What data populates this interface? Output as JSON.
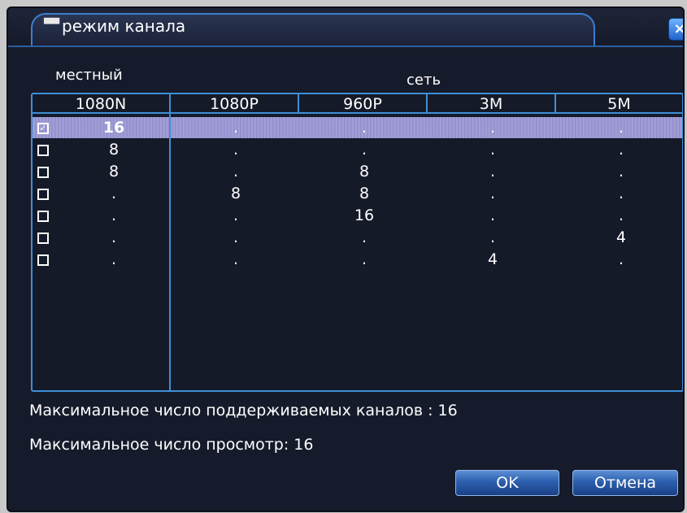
{
  "dialog": {
    "title": "режим канала",
    "close_icon": "×"
  },
  "headers": {
    "local": "местный",
    "network": "сеть",
    "columns": [
      "1080N",
      "1080P",
      "960P",
      "3M",
      "5M"
    ]
  },
  "rows": [
    {
      "checked": true,
      "check_glyph": "✓",
      "cells": [
        "16",
        ".",
        ".",
        ".",
        "."
      ]
    },
    {
      "checked": false,
      "check_glyph": "",
      "cells": [
        "8",
        ".",
        ".",
        ".",
        "."
      ]
    },
    {
      "checked": false,
      "check_glyph": "",
      "cells": [
        "8",
        ".",
        "8",
        ".",
        "."
      ]
    },
    {
      "checked": false,
      "check_glyph": "",
      "cells": [
        ".",
        "8",
        "8",
        ".",
        "."
      ]
    },
    {
      "checked": false,
      "check_glyph": "",
      "cells": [
        ".",
        ".",
        "16",
        ".",
        "."
      ]
    },
    {
      "checked": false,
      "check_glyph": "",
      "cells": [
        ".",
        ".",
        ".",
        ".",
        "4"
      ]
    },
    {
      "checked": false,
      "check_glyph": "",
      "cells": [
        ".",
        ".",
        ".",
        "4",
        "."
      ]
    }
  ],
  "info": {
    "max_channels": "Максимальное число поддерживаемых каналов : 16",
    "max_view": "Максимальное число просмотр: 16"
  },
  "buttons": {
    "ok": "OK",
    "cancel": "Отмена"
  },
  "colors": {
    "border_accent": "#3f8fd6",
    "selected_row": "#9a97d4",
    "background": "#151a29"
  }
}
